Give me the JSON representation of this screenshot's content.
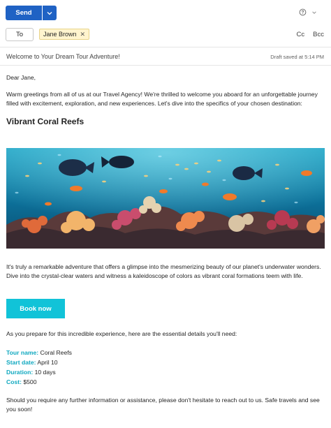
{
  "toolbar": {
    "send_label": "Send"
  },
  "recipients": {
    "to_label": "To",
    "chip_name": "Jane Brown",
    "cc_label": "Cc",
    "bcc_label": "Bcc"
  },
  "subject": {
    "text": "Welcome to Your Dream Tour Adventure!",
    "draft_status": "Draft saved at 5:14 PM"
  },
  "email": {
    "greeting": "Dear Jane,",
    "intro": "Warm greetings from all of us at our Travel Agency! We're thrilled to welcome you aboard for an unforgettable journey filled with excitement, exploration, and new experiences. Let's dive into the specifics of your chosen destination:",
    "heading": "Vibrant Coral Reefs",
    "description": "It's truly a remarkable adventure that offers a glimpse into the mesmerizing beauty of our planet's underwater wonders. Dive into the crystal-clear waters and witness a kaleidoscope of colors as vibrant coral formations teem with life.",
    "cta_label": "Book now",
    "details_intro": "As you prepare for this incredible experience, here are the essential details you'll need:",
    "details": [
      {
        "label": "Tour name:",
        "value": "Coral Reefs"
      },
      {
        "label": "Start date:",
        "value": "April 10"
      },
      {
        "label": "Duration:",
        "value": "10 days"
      },
      {
        "label": "Cost:",
        "value": "$500"
      }
    ],
    "closing": "Should you require any further information or assistance, please don't hesitate to reach out to us. Safe travels and see you soon!"
  },
  "colors": {
    "send": "#1f62c4",
    "cta": "#11c3d8",
    "detail_label": "#11a9c0",
    "chip_bg": "#fff4ce"
  },
  "icons": {
    "dropdown": "chevron-down-icon",
    "info": "info-icon",
    "chip_close": "close-icon"
  }
}
